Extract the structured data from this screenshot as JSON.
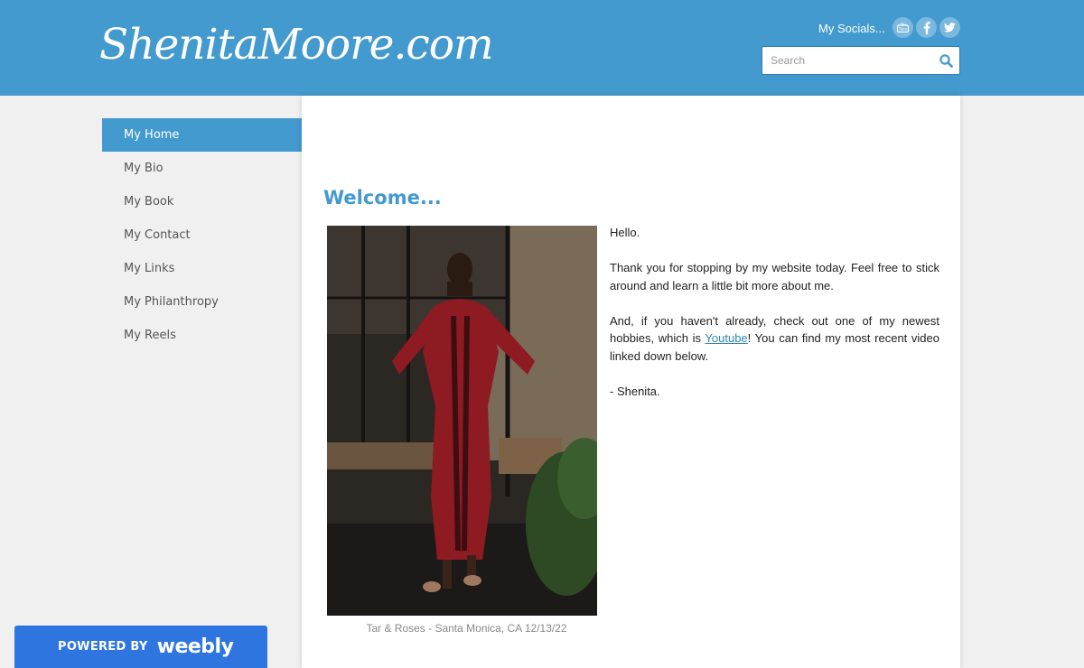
{
  "header": {
    "logo": "ShenitaMoore.com",
    "socials_label": "My Socials...",
    "social_icons": [
      "youtube-icon",
      "facebook-icon",
      "twitter-icon"
    ],
    "search_placeholder": "Search"
  },
  "nav": {
    "items": [
      {
        "label": "My Home",
        "active": true
      },
      {
        "label": "My Bio"
      },
      {
        "label": "My Book"
      },
      {
        "label": "My Contact"
      },
      {
        "label": "My Links"
      },
      {
        "label": "My Philanthropy"
      },
      {
        "label": "My Reels"
      }
    ]
  },
  "main": {
    "title": "Welcome...",
    "photo_caption": "Tar & Roses - Santa Monica, CA 12/13/22",
    "greeting": "Hello.",
    "paragraph1": "Thank you for stopping by my website today. Feel free to stick around and learn a little bit more about me.",
    "paragraph2_before": "And, if you haven't already, check out one of my newest hobbies, which is ",
    "paragraph2_link": "Youtube",
    "paragraph2_after": "! You can find my most recent video linked down below.",
    "signature": "- Shenita."
  },
  "footer": {
    "powered_by": "POWERED BY",
    "brand": "weebly"
  },
  "colors": {
    "accent": "#429acf",
    "weebly_blue": "#2f75e0",
    "page_bg": "#f0f0f0"
  }
}
